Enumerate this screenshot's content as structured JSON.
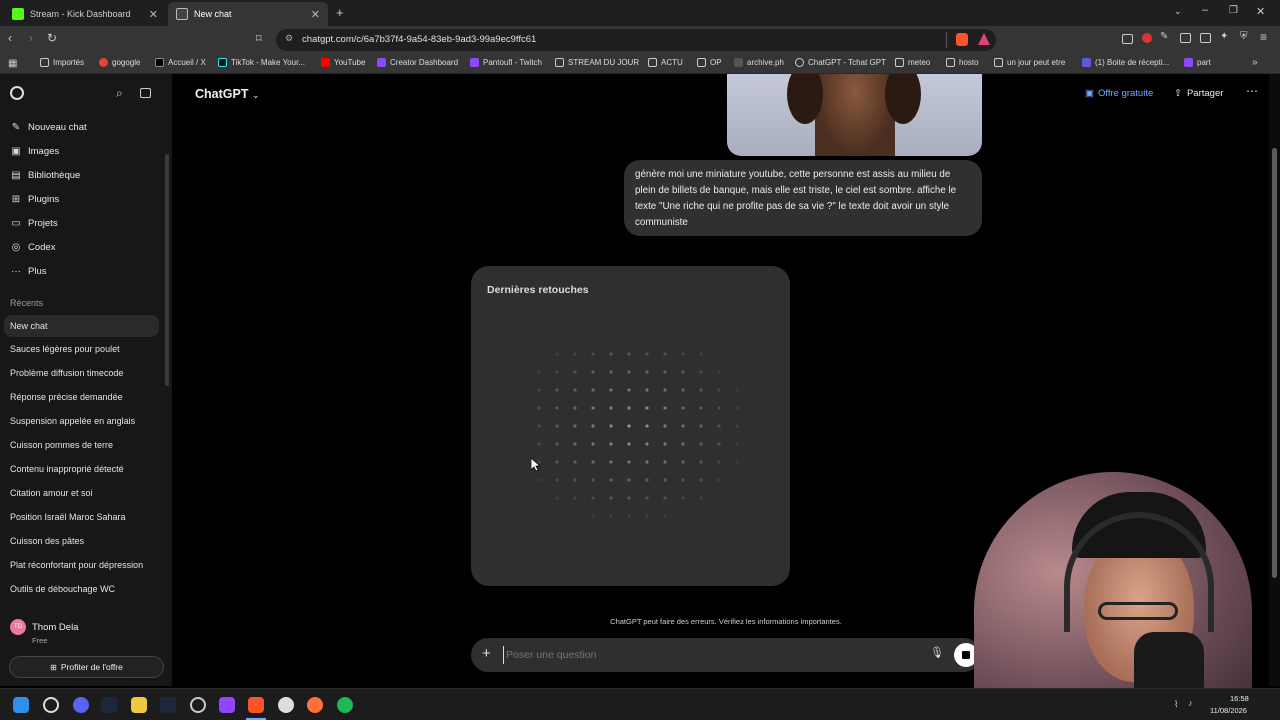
{
  "browser": {
    "tabs": [
      {
        "title": "Stream - Kick Dashboard",
        "favicon_color": "#53fc18"
      },
      {
        "title": "New chat",
        "favicon_color": "#cccccc"
      }
    ],
    "url": "chatgpt.com/c/6a7b37f4-9a54-83eb-9ad3-99a9ec9ffc61",
    "bookmarks": [
      "Importés",
      "gogogle",
      "Accueil / X",
      "TikTok - Make Your...",
      "YouTube",
      "Creator Dashboard",
      "Pantoufl - Twitch",
      "STREAM DU JOUR",
      "ACTU",
      "OP",
      "archive.ph",
      "ChatGPT - Tchat GPT",
      "meteo",
      "hosto",
      "un jour peut etre",
      "(1) Boite de récepti...",
      "part"
    ]
  },
  "sidebar": {
    "menu": [
      {
        "label": "Nouveau chat",
        "icon": "edit-icon"
      },
      {
        "label": "Images",
        "icon": "image-icon"
      },
      {
        "label": "Bibliothèque",
        "icon": "library-icon"
      },
      {
        "label": "Plugins",
        "icon": "plugins-icon"
      },
      {
        "label": "Projets",
        "icon": "folder-icon"
      },
      {
        "label": "Codex",
        "icon": "codex-icon"
      },
      {
        "label": "Plus",
        "icon": "more-icon"
      }
    ],
    "recents_title": "Récents",
    "recents": [
      "New chat",
      "Sauces légères pour poulet",
      "Problème diffusion timecode",
      "Réponse précise demandée",
      "Suspension appelée en anglais",
      "Cuisson pommes de terre",
      "Contenu inapproprié détecté",
      "Citation amour et soi",
      "Position Israël Maroc Sahara",
      "Cuisson des pâtes",
      "Plat réconfortant pour dépression",
      "Outils de débouchage WC"
    ],
    "user": {
      "initials": "TD",
      "name": "Thom Dela",
      "plan": "Free"
    },
    "upgrade_label": "Profiter de l'offre"
  },
  "header": {
    "model": "ChatGPT",
    "offer_label": "Offre gratuite",
    "share_label": "Partager"
  },
  "conversation": {
    "user_message": "génère moi une miniature youtube, cette personne est assis au milieu de plein de billets de banque, mais elle est triste, le ciel est sombre. affiche le texte \"Une riche qui ne profite pas de sa vie ?\" le texte doit avoir un style communiste",
    "generating_title": "Dernières retouches"
  },
  "footer_note": "ChatGPT peut faire des erreurs. Vérifiez les informations importantes.",
  "composer": {
    "placeholder": "Poser une question"
  },
  "taskbar": {
    "time": "16:58",
    "date": "11/08/2026"
  }
}
